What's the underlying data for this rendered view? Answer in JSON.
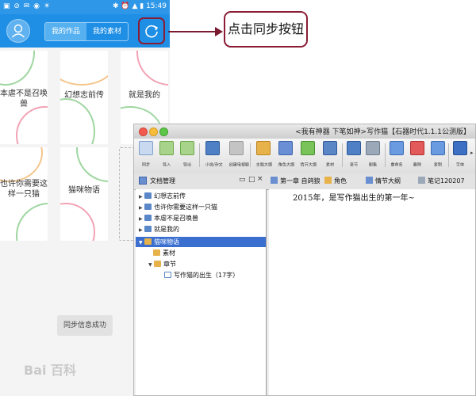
{
  "phone": {
    "status": {
      "left_icons": "▣ ⊘ ✉ ◉ ☀",
      "right_icons": "✱ ⏰ ▲ ▮",
      "time": "15:49"
    },
    "header": {
      "tabs": [
        "我的作品",
        "我的素材"
      ],
      "active_tab": 0
    },
    "cards": [
      {
        "title": "本虐不是召唤兽"
      },
      {
        "title": "幻想志前传"
      },
      {
        "title": "就是我的"
      },
      {
        "title": "也许你需要这样一只猫"
      },
      {
        "title": "猫咪物语"
      }
    ],
    "toast": "同步信息成功",
    "watermark": "Bai 百科",
    "colors": {
      "header": "#1f8ee5",
      "status": "#2e97e8",
      "highlight": "#8a1c35"
    }
  },
  "callout": {
    "text": "点击同步按钮"
  },
  "desktop": {
    "window_title": "<我有神器 下笔如神>写作猫【石器时代1.1.1公测版】",
    "toolbar": [
      {
        "label": "同步",
        "icon": "sync-icon"
      },
      {
        "label": "导入",
        "icon": "import-icon"
      },
      {
        "label": "导出",
        "icon": "export-icon"
      },
      {
        "label": "小说/杂文",
        "icon": "novel-icon"
      },
      {
        "label": "创建电视剧",
        "icon": "tv-icon"
      },
      {
        "label": "主题大纲",
        "icon": "theme-outline-icon"
      },
      {
        "label": "角色大纲",
        "icon": "role-outline-icon"
      },
      {
        "label": "情节大纲",
        "icon": "plot-outline-icon"
      },
      {
        "label": "素材",
        "icon": "material-icon"
      },
      {
        "label": "章节",
        "icon": "chapter-icon"
      },
      {
        "label": "剧集",
        "icon": "episode-icon"
      },
      {
        "label": "重命名",
        "icon": "rename-icon"
      },
      {
        "label": "删除",
        "icon": "delete-icon"
      },
      {
        "label": "复制",
        "icon": "copy-icon"
      },
      {
        "label": "字体",
        "icon": "font-icon"
      }
    ],
    "left_panel_title": "文档管理",
    "panel_controls": [
      "▭",
      "□",
      "×"
    ],
    "chapter_tabs": [
      "第一章 自鸽狼",
      "角色",
      "情节大纲",
      "笔记120207"
    ],
    "tree": [
      {
        "label": "幻想志前传",
        "level": 0
      },
      {
        "label": "也许你需要这样一只猫",
        "level": 0
      },
      {
        "label": "本虐不是召唤兽",
        "level": 0
      },
      {
        "label": "就是我的",
        "level": 0
      },
      {
        "label": "猫咪物语",
        "level": 0,
        "selected": true
      },
      {
        "label": "素材",
        "level": 1
      },
      {
        "label": "章节",
        "level": 1
      },
      {
        "label": "写作猫的出生（17字）",
        "level": 2
      }
    ],
    "editor_text": "2015年，是写作猫出生的第一年~"
  }
}
